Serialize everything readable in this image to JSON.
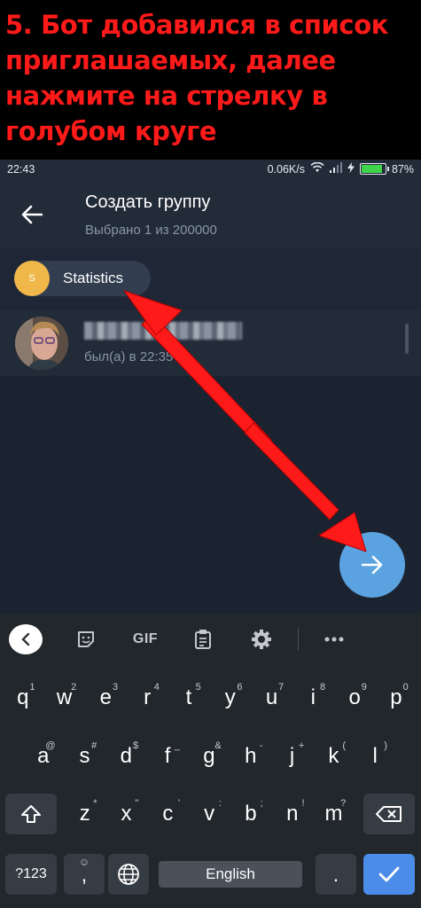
{
  "banner": {
    "text": "5. Бот добавился в список приглашаемых, далее нажмите на стрелку в голубом круге"
  },
  "statusbar": {
    "time": "22:43",
    "speed": "0.06K/s",
    "battery_pct": "87%",
    "battery_level": 0.87
  },
  "header": {
    "title": "Создать группу",
    "subtitle": "Выбрано 1 из 200000",
    "back_icon": "arrow-left-icon"
  },
  "selected_chips": [
    {
      "avatar_letter": "S",
      "label": "Statistics",
      "avatar_color": "#f0b74a"
    }
  ],
  "contacts": [
    {
      "name": "",
      "status": "был(а) в 22:35"
    }
  ],
  "fab": {
    "icon": "arrow-right-icon",
    "color": "#5aa3e0"
  },
  "annotation": {
    "arrow_color": "#ff1a1a"
  },
  "keyboard": {
    "toolbar": [
      "collapse-icon",
      "sticker-icon",
      "GIF",
      "clipboard-icon",
      "gear-icon",
      "more-icon"
    ],
    "gif_label": "GIF",
    "row1": [
      {
        "k": "q",
        "s": "1"
      },
      {
        "k": "w",
        "s": "2"
      },
      {
        "k": "e",
        "s": "3"
      },
      {
        "k": "r",
        "s": "4"
      },
      {
        "k": "t",
        "s": "5"
      },
      {
        "k": "y",
        "s": "6"
      },
      {
        "k": "u",
        "s": "7"
      },
      {
        "k": "i",
        "s": "8"
      },
      {
        "k": "o",
        "s": "9"
      },
      {
        "k": "p",
        "s": "0"
      }
    ],
    "row2": [
      {
        "k": "a",
        "s": "@"
      },
      {
        "k": "s",
        "s": "#"
      },
      {
        "k": "d",
        "s": "$"
      },
      {
        "k": "f",
        "s": "_"
      },
      {
        "k": "g",
        "s": "&"
      },
      {
        "k": "h",
        "s": "-"
      },
      {
        "k": "j",
        "s": "+"
      },
      {
        "k": "k",
        "s": "("
      },
      {
        "k": "l",
        "s": ")"
      }
    ],
    "row3": [
      {
        "k": "z",
        "s": "*"
      },
      {
        "k": "x",
        "s": "\""
      },
      {
        "k": "c",
        "s": "'"
      },
      {
        "k": "v",
        "s": ":"
      },
      {
        "k": "b",
        "s": ";"
      },
      {
        "k": "n",
        "s": "!"
      },
      {
        "k": "m",
        "s": "?"
      }
    ],
    "symbols_label": "?123",
    "comma": ",",
    "space_label": "English",
    "period": "."
  }
}
